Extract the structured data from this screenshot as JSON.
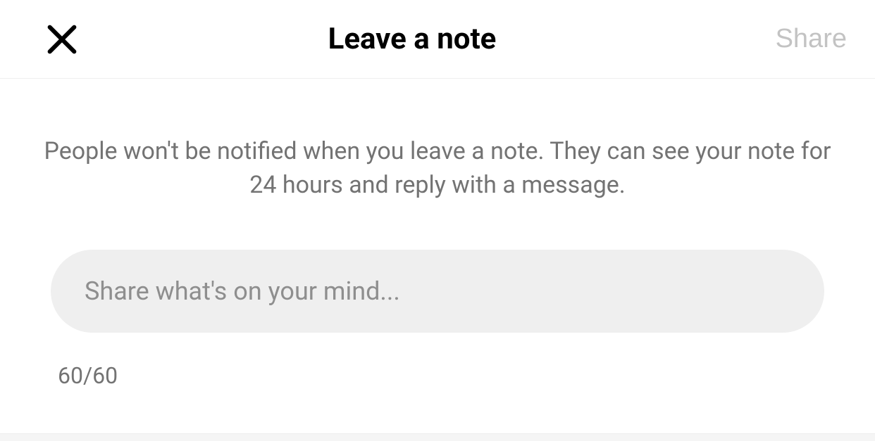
{
  "header": {
    "title": "Leave a note",
    "share_label": "Share"
  },
  "main": {
    "description": "People won't be notified when you leave a note. They can see your note for 24 hours and reply with a message.",
    "input_placeholder": "Share what's on your mind...",
    "input_value": "",
    "counter": "60/60"
  }
}
